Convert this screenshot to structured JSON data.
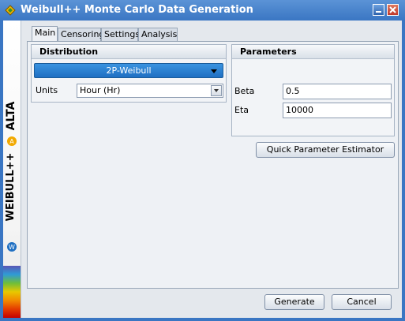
{
  "window": {
    "title": "Weibull++ Monte Carlo Data Generation"
  },
  "sidebar": {
    "product_top": "ALTA",
    "product_bottom": "WEIBULL++"
  },
  "tabs": [
    {
      "label": "Main",
      "active": true
    },
    {
      "label": "Censoring",
      "active": false
    },
    {
      "label": "Settings",
      "active": false
    },
    {
      "label": "Analysis",
      "active": false
    }
  ],
  "distribution": {
    "header": "Distribution",
    "selected": "2P-Weibull",
    "units_label": "Units",
    "units_value": "Hour (Hr)"
  },
  "parameters": {
    "header": "Parameters",
    "beta_label": "Beta",
    "beta_value": "0.5",
    "eta_label": "Eta",
    "eta_value": "10000"
  },
  "buttons": {
    "quick_estimator": "Quick Parameter Estimator",
    "generate": "Generate",
    "cancel": "Cancel"
  },
  "colors": {
    "titlebar": "#3a76c3",
    "accent_button": "#1f6fc2"
  }
}
